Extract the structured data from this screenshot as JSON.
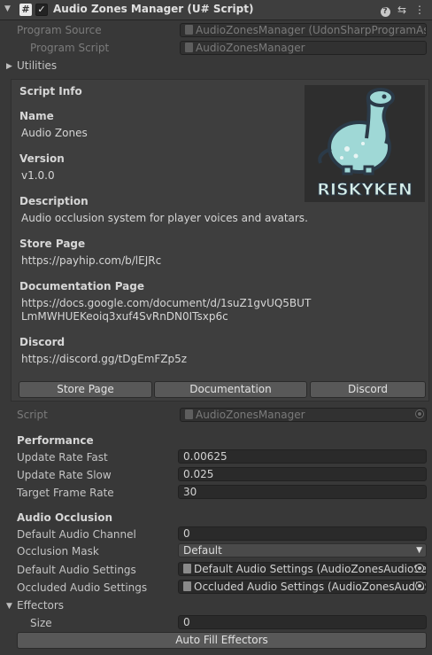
{
  "header": {
    "title": "Audio Zones Manager (U# Script)",
    "script_glyph": "#",
    "check_glyph": "✓",
    "icons": [
      "help-icon",
      "preset-icon",
      "menu-icon"
    ],
    "help_glyph": "?",
    "preset_glyph": "⇆",
    "menu_glyph": "⋮"
  },
  "program": {
    "source_label": "Program Source",
    "source_value": "AudioZonesManager (UdonSharpProgramAs",
    "script_label": "Program Script",
    "script_value": "AudioZonesManager"
  },
  "utilities_label": "Utilities",
  "info": {
    "script_info": "Script Info",
    "name_label": "Name",
    "name_value": "Audio Zones",
    "version_label": "Version",
    "version_value": "v1.0.0",
    "description_label": "Description",
    "description_value": "Audio occlusion system for player voices and avatars.",
    "store_label": "Store Page",
    "store_value": "https://payhip.com/b/lEJRc",
    "docs_label": "Documentation Page",
    "docs_line1": "https://docs.google.com/document/d/1suZ1gvUQ5BUT",
    "docs_line2": "LmMWHUEKeoiq3xuf4SvRnDN0ITsxp6c",
    "discord_label": "Discord",
    "discord_value": "https://discord.gg/tDgEmFZp5z",
    "logo_text": "RISKYKEN",
    "buttons": {
      "store": "Store Page",
      "documentation": "Documentation",
      "discord": "Discord"
    }
  },
  "script": {
    "label": "Script",
    "value": "AudioZonesManager"
  },
  "performance": {
    "header": "Performance",
    "fast_label": "Update Rate Fast",
    "fast_value": "0.00625",
    "slow_label": "Update Rate Slow",
    "slow_value": "0.025",
    "target_label": "Target Frame Rate",
    "target_value": "30"
  },
  "occlusion": {
    "header": "Audio Occlusion",
    "channel_label": "Default Audio Channel",
    "channel_value": "0",
    "mask_label": "Occlusion Mask",
    "mask_value": "Default",
    "default_settings_label": "Default Audio Settings",
    "default_settings_value": "Default Audio Settings (AudioZonesAudioSe",
    "occluded_settings_label": "Occluded Audio Settings",
    "occluded_settings_value": "Occluded Audio Settings (AudioZonesAudioS"
  },
  "effectors": {
    "label": "Effectors",
    "size_label": "Size",
    "size_value": "0",
    "autofill_button": "Auto Fill Effectors"
  },
  "colors": {
    "background": "#383838",
    "panel": "#3e3e3e",
    "field": "#2a2a2a",
    "button": "#585858",
    "logo_mint": "#9fd8d6",
    "logo_dark": "#2b3a48"
  }
}
